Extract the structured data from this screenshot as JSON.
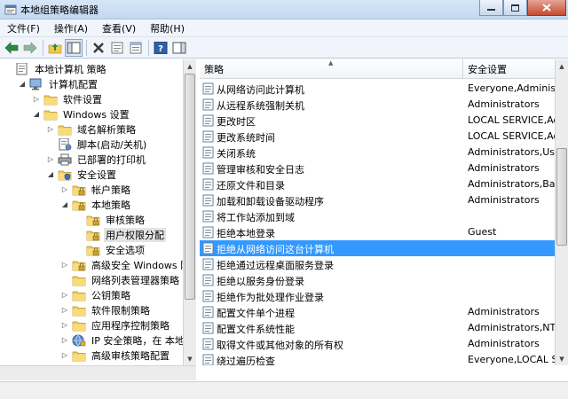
{
  "window": {
    "title": "本地组策略编辑器"
  },
  "menu": [
    {
      "label": "文件(F)"
    },
    {
      "label": "操作(A)"
    },
    {
      "label": "查看(V)"
    },
    {
      "label": "帮助(H)"
    }
  ],
  "tree": [
    {
      "label": "本地计算机 策略",
      "twisty": "",
      "icon": "computer-policy",
      "level": 0
    },
    {
      "label": "计算机配置",
      "twisty": "expanded",
      "icon": "computer",
      "level": 1
    },
    {
      "label": "软件设置",
      "twisty": "collapsed",
      "icon": "folder",
      "level": 2
    },
    {
      "label": "Windows 设置",
      "twisty": "expanded",
      "icon": "folder",
      "level": 2
    },
    {
      "label": "域名解析策略",
      "twisty": "collapsed",
      "icon": "folder",
      "level": 3
    },
    {
      "label": "脚本(启动/关机)",
      "twisty": "",
      "icon": "script",
      "level": 3
    },
    {
      "label": "已部署的打印机",
      "twisty": "collapsed",
      "icon": "printer",
      "level": 3
    },
    {
      "label": "安全设置",
      "twisty": "expanded",
      "icon": "security",
      "level": 3
    },
    {
      "label": "帐户策略",
      "twisty": "collapsed",
      "icon": "folder-lock",
      "level": 4
    },
    {
      "label": "本地策略",
      "twisty": "expanded",
      "icon": "folder-lock",
      "level": 4
    },
    {
      "label": "审核策略",
      "twisty": "",
      "icon": "folder-lock",
      "level": 5
    },
    {
      "label": "用户权限分配",
      "twisty": "",
      "icon": "folder-lock",
      "level": 5,
      "selected": true
    },
    {
      "label": "安全选项",
      "twisty": "",
      "icon": "folder-lock",
      "level": 5
    },
    {
      "label": "高级安全 Windows 防火墙",
      "twisty": "collapsed",
      "icon": "folder-lock",
      "level": 4
    },
    {
      "label": "网络列表管理器策略",
      "twisty": "",
      "icon": "folder",
      "level": 4
    },
    {
      "label": "公钥策略",
      "twisty": "collapsed",
      "icon": "folder",
      "level": 4
    },
    {
      "label": "软件限制策略",
      "twisty": "collapsed",
      "icon": "folder",
      "level": 4
    },
    {
      "label": "应用程序控制策略",
      "twisty": "collapsed",
      "icon": "folder",
      "level": 4
    },
    {
      "label": "IP 安全策略，在 本地计算机",
      "twisty": "collapsed",
      "icon": "ip-security",
      "level": 4
    },
    {
      "label": "高级审核策略配置",
      "twisty": "collapsed",
      "icon": "folder",
      "level": 4
    }
  ],
  "columns": {
    "policy": "策略",
    "security": "安全设置"
  },
  "policies": [
    {
      "name": "从网络访问此计算机",
      "security": "Everyone,Administrators"
    },
    {
      "name": "从远程系统强制关机",
      "security": "Administrators"
    },
    {
      "name": "更改时区",
      "security": "LOCAL SERVICE,Administrators"
    },
    {
      "name": "更改系统时间",
      "security": "LOCAL SERVICE,Administrators"
    },
    {
      "name": "关闭系统",
      "security": "Administrators,Users"
    },
    {
      "name": "管理审核和安全日志",
      "security": "Administrators"
    },
    {
      "name": "还原文件和目录",
      "security": "Administrators,Backup"
    },
    {
      "name": "加载和卸载设备驱动程序",
      "security": "Administrators"
    },
    {
      "name": "将工作站添加到域",
      "security": ""
    },
    {
      "name": "拒绝本地登录",
      "security": "Guest"
    },
    {
      "name": "拒绝从网络访问这台计算机",
      "security": "",
      "selected": true
    },
    {
      "name": "拒绝通过远程桌面服务登录",
      "security": ""
    },
    {
      "name": "拒绝以服务身份登录",
      "security": ""
    },
    {
      "name": "拒绝作为批处理作业登录",
      "security": ""
    },
    {
      "name": "配置文件单个进程",
      "security": "Administrators"
    },
    {
      "name": "配置文件系统性能",
      "security": "Administrators,NT Service"
    },
    {
      "name": "取得文件或其他对象的所有权",
      "security": "Administrators"
    },
    {
      "name": "绕过遍历检查",
      "security": "Everyone,LOCAL SERVICE"
    }
  ]
}
